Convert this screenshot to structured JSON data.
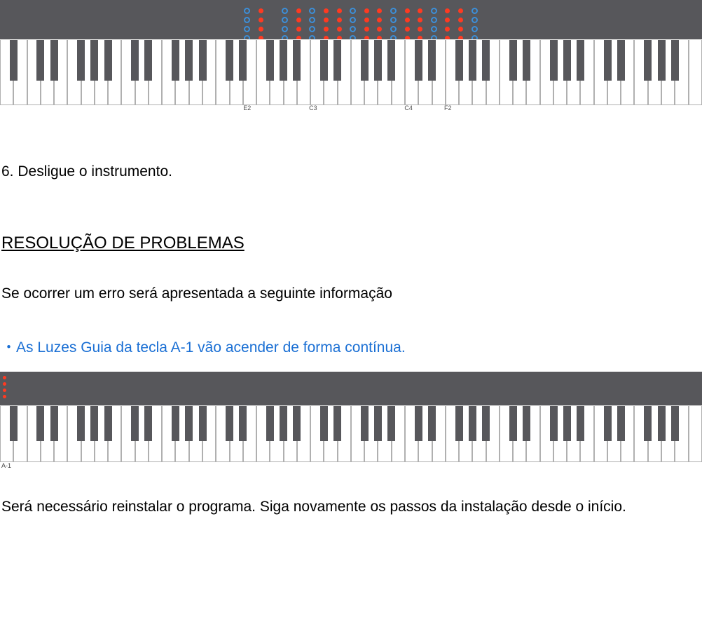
{
  "panel1": {
    "led_rows": [
      "b.r....b.r.b.r.r.b.r.r.b.r.r.b.r.r.b",
      "b.r....b.r.b.r.r.b.r.r.b.r.r.b.r.r.b",
      "b.r....b.r.b.r.r.b.r.r.b.r.r.b.r.r.b",
      "b.r....b.r.b.r.r.b.r.r.b.r.r.b.r.r.b"
    ],
    "note_labels": [
      {
        "text": "E2",
        "position_pct": 35.2
      },
      {
        "text": "C3",
        "position_pct": 44.6
      },
      {
        "text": "C4",
        "position_pct": 58.2
      },
      {
        "text": "F2",
        "position_pct": 63.8
      }
    ]
  },
  "step6": "6. Desligue o instrumento.",
  "heading": "RESOLUÇÃO DE PROBLEMAS",
  "para1": "Se ocorrer um erro será apresentada a seguinte informação",
  "bullet1": "・As Luzes Guia da tecla A-1 vão acender de forma contínua.",
  "panel2": {
    "label": "A-1"
  },
  "para2": "Será necessário reinstalar o programa. Siga novamente os passos da instalação desde o início."
}
